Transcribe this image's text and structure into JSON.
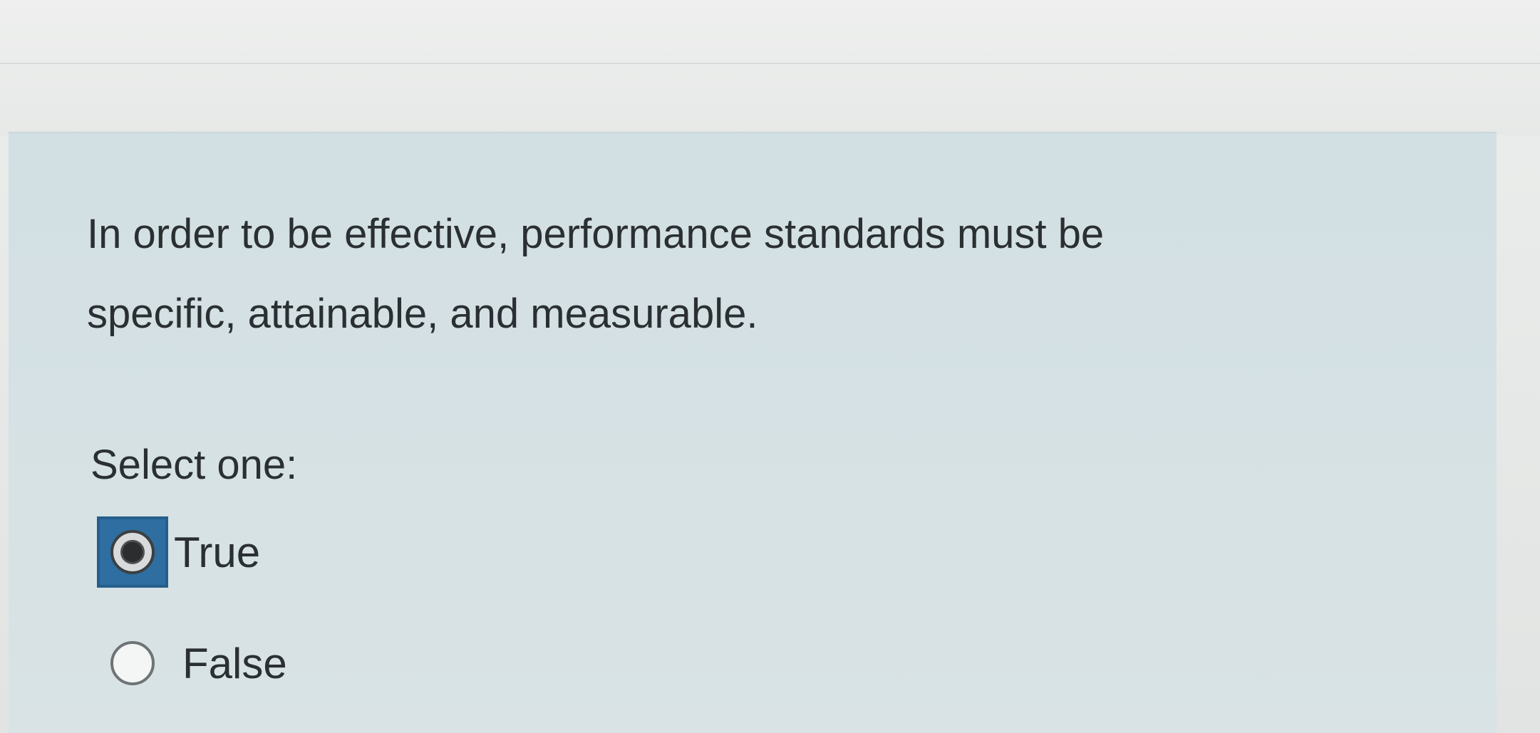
{
  "question": {
    "text_line1": "In order to be effective, performance standards must be",
    "text_line2": "specific, attainable, and measurable.",
    "prompt": "Select one:"
  },
  "options": [
    {
      "label": "True",
      "selected": true
    },
    {
      "label": "False",
      "selected": false
    }
  ],
  "colors": {
    "panel_background": "#d4e0e3",
    "focus_ring": "#2e6ea0",
    "text": "#2a2f32"
  }
}
